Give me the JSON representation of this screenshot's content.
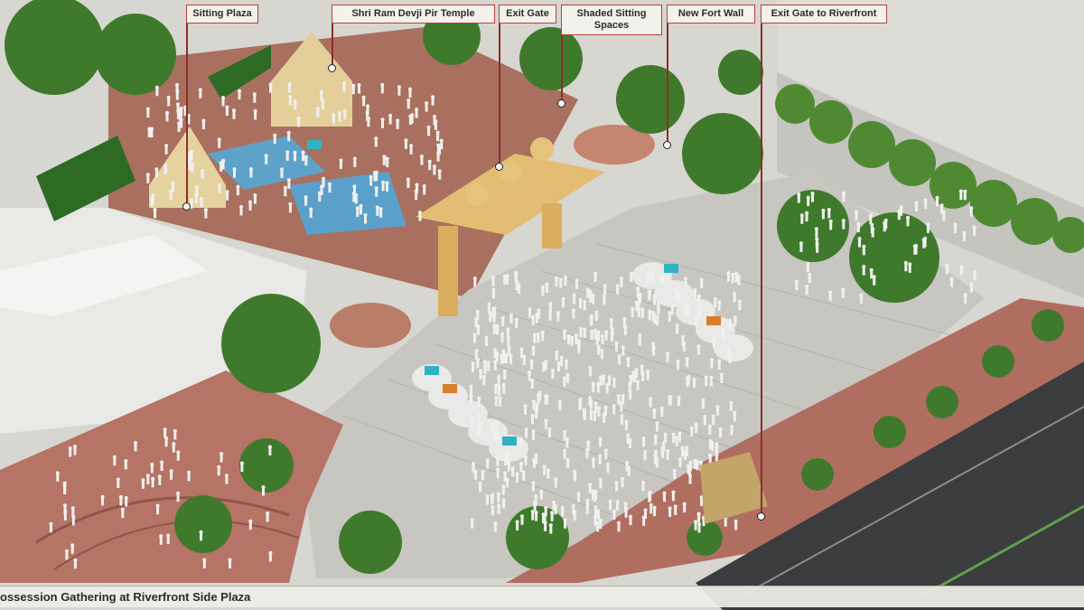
{
  "caption": "ossession Gathering at Riverfront Side Plaza",
  "callouts": [
    {
      "label": "Sitting Plaza"
    },
    {
      "label": "Shri Ram Devji Pir Temple"
    },
    {
      "label": "Exit Gate"
    },
    {
      "label": "Shaded Sitting Spaces"
    },
    {
      "label": "New Fort Wall"
    },
    {
      "label": "Exit Gate to Riverfront"
    }
  ],
  "colors": {
    "brick_paving": "#b97565",
    "plaza_gray": "#c9c7c2",
    "tree_green": "#3f7a2c",
    "gate_sandstone": "#e2bd73",
    "callout_border": "#b3413c"
  }
}
